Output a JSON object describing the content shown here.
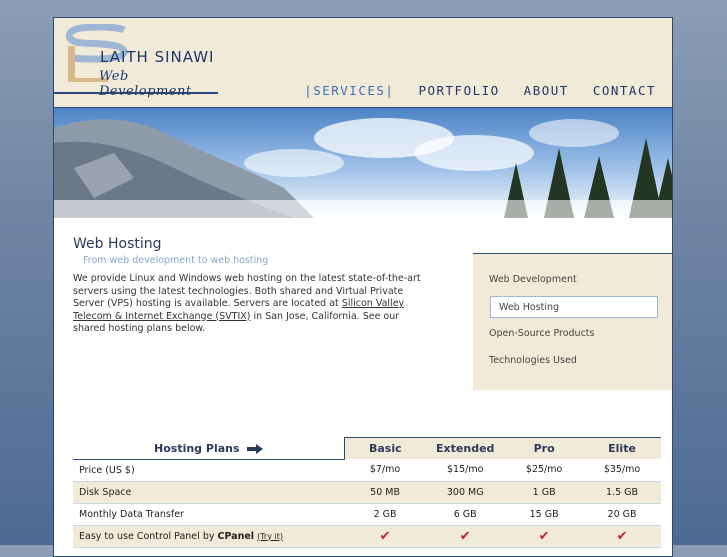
{
  "brand": {
    "name": "LAITH SINAWI",
    "tagline": "Web Development"
  },
  "nav": {
    "items": [
      {
        "label": "|SERVICES|",
        "active": true
      },
      {
        "label": "PORTFOLIO",
        "active": false
      },
      {
        "label": "ABOUT",
        "active": false
      },
      {
        "label": "CONTACT",
        "active": false
      }
    ]
  },
  "main": {
    "title": "Web Hosting",
    "subtitle": "From web development to web hosting",
    "intro_1": "We provide Linux and Windows web hosting on the latest state-of-the-art servers using the latest technologies. Both shared and Virtual Private Server (VPS) hosting is available. Servers are located at ",
    "intro_link": "Silicon Valley Telecom & Internet Exchange (SVTIX)",
    "intro_2": " in San Jose, California. See our shared hosting plans below."
  },
  "sidebar": {
    "items": [
      {
        "label": "Web Development"
      },
      {
        "label": "Web Hosting",
        "active": true
      },
      {
        "label": "Open-Source Products"
      },
      {
        "label": "Technologies Used"
      }
    ]
  },
  "plans": {
    "header_label": "Hosting Plans",
    "columns": [
      "Basic",
      "Extended",
      "Pro",
      "Elite"
    ],
    "rows": [
      {
        "label": "Price (US $)",
        "values": [
          "$7/mo",
          "$15/mo",
          "$25/mo",
          "$35/mo"
        ]
      },
      {
        "label": "Disk Space",
        "values": [
          "50 MB",
          "300 MG",
          "1 GB",
          "1.5 GB"
        ]
      },
      {
        "label": "Monthly Data Transfer",
        "values": [
          "2 GB",
          "6 GB",
          "15 GB",
          "20 GB"
        ]
      },
      {
        "label_prefix": "Easy to use Control Panel by ",
        "label_bold": "CPanel",
        "link": "(Try it)",
        "values": [
          "✔",
          "✔",
          "✔",
          "✔"
        ]
      }
    ]
  },
  "colors": {
    "navy": "#1f3768",
    "cream": "#f2ead8",
    "accent": "#3f6fb0",
    "check": "#c3202a"
  }
}
